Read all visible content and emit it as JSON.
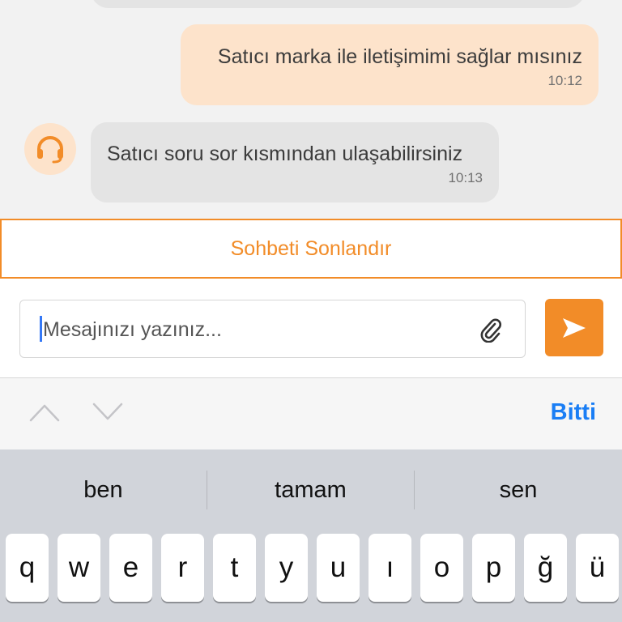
{
  "chat": {
    "messages": [
      {
        "sender": "user",
        "text": "Satıcı marka ile iletişimimi sağlar mısınız",
        "time": "10:12"
      },
      {
        "sender": "agent",
        "text": "Satıcı soru sor kısmından ulaşabilirsiniz",
        "time": "10:13"
      }
    ]
  },
  "end_chat": {
    "label": "Sohbeti Sonlandır"
  },
  "composer": {
    "placeholder": "Mesajınızı yazınız..."
  },
  "keyboard_toolbar": {
    "done_label": "Bitti"
  },
  "keyboard": {
    "suggestions": [
      "ben",
      "tamam",
      "sen"
    ],
    "row1": [
      "q",
      "w",
      "e",
      "r",
      "t",
      "y",
      "u",
      "ı",
      "o",
      "p",
      "ğ",
      "ü"
    ]
  },
  "colors": {
    "accent": "#f28c28",
    "user_bubble": "#fde3cb",
    "agent_bubble": "#e4e4e4",
    "link_blue": "#1a7ef5"
  },
  "icons": {
    "agent_avatar": "headset-icon",
    "attach": "paperclip-icon",
    "send": "send-icon"
  }
}
